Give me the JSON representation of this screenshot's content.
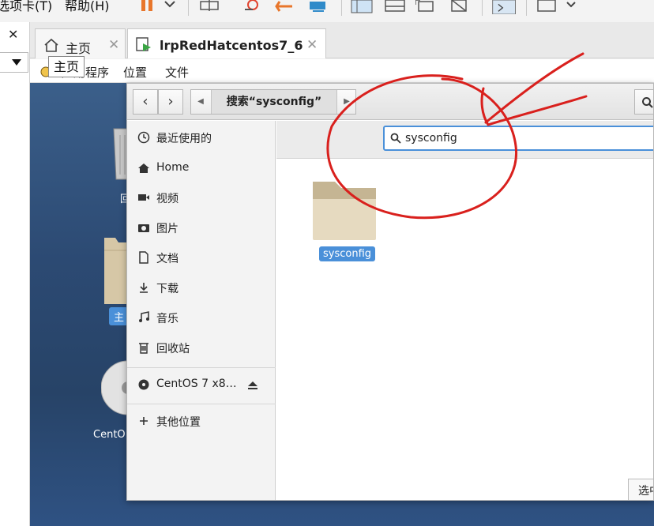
{
  "vmware": {
    "menu": {
      "item_left": "选项卡(T)",
      "item_help": "帮助(H)"
    },
    "library_close": "✕",
    "tabs": [
      {
        "label": "主页",
        "close": "✕"
      },
      {
        "label": "lrpRedHatcentos7_6",
        "close": "✕"
      }
    ],
    "tooltip": "主页"
  },
  "gnome_menu": {
    "apps": "应用程序",
    "places": "位置",
    "files": "文件"
  },
  "desktop_icons": {
    "trash": "回",
    "home": "主",
    "disc": "CentO"
  },
  "nautilus": {
    "nav": {
      "back": "‹",
      "forward": "›"
    },
    "path": "搜索“sysconfig”",
    "search_value": "sysconfig",
    "sidebar": [
      {
        "label": "最近使用的",
        "icon": "clock-icon"
      },
      {
        "label": "Home",
        "icon": "home-icon"
      },
      {
        "label": "视频",
        "icon": "video-icon"
      },
      {
        "label": "图片",
        "icon": "camera-icon"
      },
      {
        "label": "文档",
        "icon": "document-icon"
      },
      {
        "label": "下载",
        "icon": "download-icon"
      },
      {
        "label": "音乐",
        "icon": "music-icon"
      },
      {
        "label": "回收站",
        "icon": "trash-icon"
      }
    ],
    "device": {
      "label": "CentOS 7 x8…",
      "icon": "disc-icon"
    },
    "other": {
      "label": "其他位置",
      "icon": "plus-icon"
    },
    "files": [
      {
        "name": "sysconfig",
        "icon": "folder-icon"
      }
    ],
    "status_button": "选中"
  },
  "colors": {
    "accent": "#4a90d9",
    "annotation": "#d9201d"
  }
}
